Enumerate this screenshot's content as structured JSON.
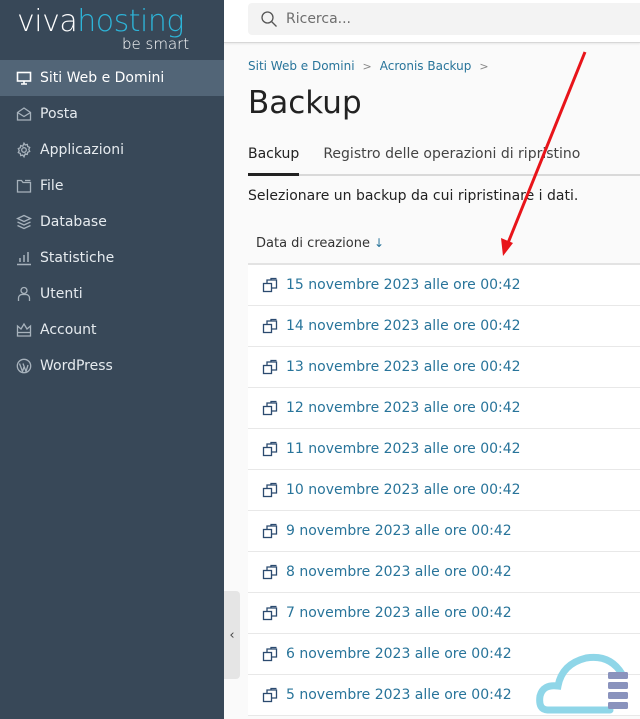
{
  "brand": {
    "name_part1": "viva",
    "name_part2": "hosting",
    "tagline": "be smart"
  },
  "sidebar": {
    "items": [
      {
        "label": "Siti Web e Domini",
        "icon": "monitor-icon",
        "active": true
      },
      {
        "label": "Posta",
        "icon": "mail-icon",
        "active": false
      },
      {
        "label": "Applicazioni",
        "icon": "gear-icon",
        "active": false
      },
      {
        "label": "File",
        "icon": "folder-icon",
        "active": false
      },
      {
        "label": "Database",
        "icon": "layers-icon",
        "active": false
      },
      {
        "label": "Statistiche",
        "icon": "bar-chart-icon",
        "active": false
      },
      {
        "label": "Utenti",
        "icon": "user-icon",
        "active": false
      },
      {
        "label": "Account",
        "icon": "crown-icon",
        "active": false
      },
      {
        "label": "WordPress",
        "icon": "wordpress-icon",
        "active": false
      }
    ],
    "collapse_glyph": "‹"
  },
  "header": {
    "search_placeholder": "Ricerca..."
  },
  "breadcrumb": {
    "items": [
      "Siti Web e Domini",
      "Acronis Backup"
    ],
    "separator": ">"
  },
  "page": {
    "title": "Backup",
    "tabs": [
      {
        "label": "Backup",
        "active": true
      },
      {
        "label": "Registro delle operazioni di ripristino",
        "active": false
      }
    ],
    "description": "Selezionare un backup da cui ripristinare i dati."
  },
  "table": {
    "column_header": "Data di creazione",
    "sort_glyph": "↓",
    "rows": [
      "15 novembre 2023 alle ore 00:42",
      "14 novembre 2023 alle ore 00:42",
      "13 novembre 2023 alle ore 00:42",
      "12 novembre 2023 alle ore 00:42",
      "11 novembre 2023 alle ore 00:42",
      "10 novembre 2023 alle ore 00:42",
      "9 novembre 2023 alle ore 00:42",
      "8 novembre 2023 alle ore 00:42",
      "7 novembre 2023 alle ore 00:42",
      "6 novembre 2023 alle ore 00:42",
      "5 novembre 2023 alle ore 00:42"
    ]
  },
  "colors": {
    "sidebar_bg": "#384858",
    "sidebar_active": "#526577",
    "link": "#28749a",
    "brand_accent": "#2db4d8",
    "annotation_arrow": "#e8141a"
  }
}
